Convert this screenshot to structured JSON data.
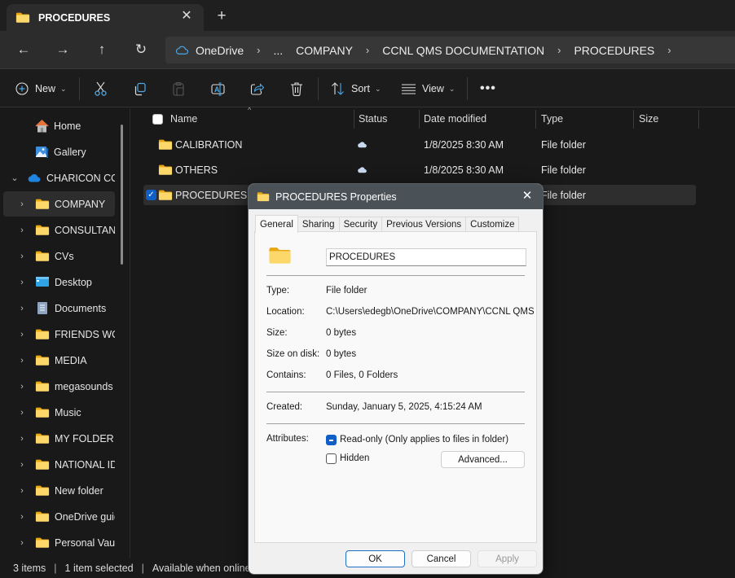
{
  "window": {
    "tab_title": "PROCEDURES",
    "close_tab_icon": "close-icon",
    "new_tab_icon": "plus-icon"
  },
  "navigation": {
    "back_icon": "arrow-left-icon",
    "forward_icon": "arrow-right-icon",
    "up_icon": "arrow-up-icon",
    "refresh_icon": "refresh-icon",
    "breadcrumb": [
      "OneDrive",
      "...",
      "COMPANY",
      "CCNL QMS DOCUMENTATION",
      "PROCEDURES"
    ]
  },
  "toolbar": {
    "new_label": "New",
    "sort_label": "Sort",
    "view_label": "View",
    "icons": [
      "cut-icon",
      "copy-icon",
      "paste-icon",
      "rename-icon",
      "share-icon",
      "delete-icon",
      "more-icon"
    ]
  },
  "sidebar": {
    "items": [
      {
        "label": "Home",
        "icon": "home-icon",
        "expandable": false
      },
      {
        "label": "Gallery",
        "icon": "gallery-icon",
        "expandable": false
      },
      {
        "label": "CHARICON COI",
        "icon": "onedrive-cloud-icon",
        "expanded": true
      },
      {
        "label": "COMPANY",
        "icon": "folder-icon",
        "selected": true
      },
      {
        "label": "CONSULTANC",
        "icon": "folder-icon"
      },
      {
        "label": "CVs",
        "icon": "folder-icon"
      },
      {
        "label": "Desktop",
        "icon": "desktop-icon"
      },
      {
        "label": "Documents",
        "icon": "documents-icon"
      },
      {
        "label": "FRIENDS WOR",
        "icon": "folder-icon"
      },
      {
        "label": "MEDIA",
        "icon": "folder-icon"
      },
      {
        "label": "megasounds p",
        "icon": "folder-icon"
      },
      {
        "label": "Music",
        "icon": "folder-icon"
      },
      {
        "label": "MY FOLDER",
        "icon": "folder-icon"
      },
      {
        "label": "NATIONAL ID",
        "icon": "folder-icon"
      },
      {
        "label": "New folder",
        "icon": "folder-icon"
      },
      {
        "label": "OneDrive guid",
        "icon": "folder-icon"
      },
      {
        "label": "Personal Vault",
        "icon": "folder-icon"
      }
    ]
  },
  "file_list": {
    "columns": [
      "Name",
      "Status",
      "Date modified",
      "Type",
      "Size"
    ],
    "rows": [
      {
        "name": "CALIBRATION",
        "status": "cloud-icon",
        "date": "1/8/2025 8:30 AM",
        "type": "File folder",
        "size": "",
        "selected": false
      },
      {
        "name": "OTHERS",
        "status": "cloud-icon",
        "date": "1/8/2025 8:30 AM",
        "type": "File folder",
        "size": "",
        "selected": false
      },
      {
        "name": "PROCEDURES",
        "status": "",
        "date": "",
        "type": "File folder",
        "size": "",
        "selected": true
      }
    ]
  },
  "statusbar": {
    "item_count": "3 items",
    "selected": "1 item selected",
    "availability": "Available when online"
  },
  "dialog": {
    "title": "PROCEDURES Properties",
    "tabs": [
      "General",
      "Sharing",
      "Security",
      "Previous Versions",
      "Customize"
    ],
    "active_tab": "General",
    "name_value": "PROCEDURES",
    "properties": {
      "type_label": "Type:",
      "type_value": "File folder",
      "location_label": "Location:",
      "location_value": "C:\\Users\\edegb\\OneDrive\\COMPANY\\CCNL QMS",
      "size_label": "Size:",
      "size_value": "0 bytes",
      "size_on_disk_label": "Size on disk:",
      "size_on_disk_value": "0 bytes",
      "contains_label": "Contains:",
      "contains_value": "0 Files, 0 Folders",
      "created_label": "Created:",
      "created_value": "Sunday, January 5, 2025, 4:15:24 AM",
      "attributes_label": "Attributes:"
    },
    "attributes": {
      "readonly_label": "Read-only (Only applies to files in folder)",
      "readonly_state": "indeterminate",
      "hidden_label": "Hidden",
      "hidden_state": "unchecked",
      "advanced_label": "Advanced..."
    },
    "buttons": {
      "ok": "OK",
      "cancel": "Cancel",
      "apply": "Apply"
    }
  },
  "colors": {
    "accent": "#0f5fc6",
    "folder_yellow": "#f7c948",
    "onedrive_blue": "#2e8ce6",
    "dialog_titlebar": "#4b5257"
  }
}
